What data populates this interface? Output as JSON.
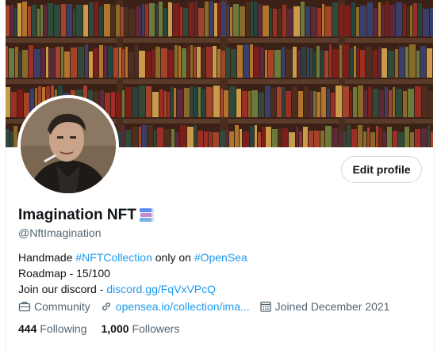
{
  "profile": {
    "display_name": "Imagination NFT",
    "name_emoji_icon": "books-icon",
    "handle": "@NftImagination",
    "edit_label": "Edit profile",
    "bio": {
      "line1_prefix": "Handmade ",
      "line1_tag1": "#NFTCollection",
      "line1_mid": " only on ",
      "line1_tag2": "#OpenSea",
      "line2": "Roadmap - 15/100",
      "line3_prefix": "Join our discord - ",
      "line3_link": "discord.gg/FqVxVPcQ"
    },
    "meta": {
      "category_icon": "briefcase-icon",
      "category": "Community",
      "link_icon": "link-icon",
      "website": "opensea.io/collection/ima...",
      "joined_icon": "calendar-icon",
      "joined": "Joined December 2021"
    },
    "stats": {
      "following_count": "444",
      "following_label": "Following",
      "followers_count": "1,000",
      "followers_label": "Followers"
    }
  },
  "colors": {
    "accent": "#1d9bf0",
    "secondary_text": "#536471",
    "primary_text": "#0f1419",
    "border": "#cfd9de"
  }
}
